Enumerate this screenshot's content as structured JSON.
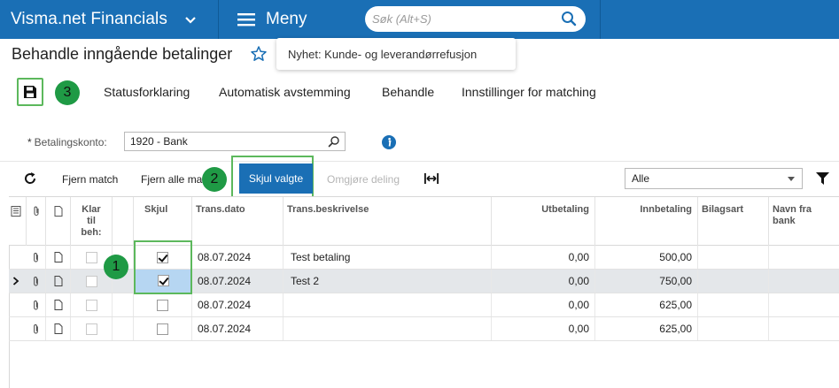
{
  "topbar": {
    "app_title": "Visma.net Financials",
    "menu_label": "Meny",
    "search_placeholder": "Søk (Alt+S)",
    "color": "#1a6fb5"
  },
  "page": {
    "title": "Behandle inngående betalinger",
    "news_tooltip": "Nyhet: Kunde- og leverandørrefusjon"
  },
  "toolbar": {
    "actions": [
      "Statusforklaring",
      "Automatisk avstemming",
      "Behandle",
      "Innstillinger for matching"
    ]
  },
  "callouts": [
    "1",
    "2",
    "3"
  ],
  "form": {
    "account_label": "Betalingskonto:",
    "required_mark": "*",
    "account_value": "1920 - Bank"
  },
  "grid_toolbar": {
    "remove_match": "Fjern match",
    "remove_all_matches": "Fjern alle ma",
    "hide_selected": "Skjul valgte",
    "undo_split": "Omgjøre deling",
    "filter_value": "Alle"
  },
  "grid": {
    "headers": {
      "ready": "Klar til behandling",
      "hide": "Skjul",
      "trans_date": "Trans.dato",
      "trans_desc": "Trans.beskrivelse",
      "payment_out": "Utbetaling",
      "payment_in": "Innbetaling",
      "voucher_type": "Bilagsart",
      "bank_name": "Navn fra bank"
    },
    "header_ready_lines": [
      "Klar",
      "til",
      "beh:"
    ],
    "header_bank_lines": [
      "Navn fra",
      "bank"
    ],
    "rows": [
      {
        "hide": true,
        "date": "08.07.2024",
        "desc": "Test betaling",
        "out": "0,00",
        "in": "500,00",
        "selected": false
      },
      {
        "hide": true,
        "date": "08.07.2024",
        "desc": "Test 2",
        "out": "0,00",
        "in": "750,00",
        "selected": true
      },
      {
        "hide": false,
        "date": "08.07.2024",
        "desc": "",
        "out": "0,00",
        "in": "625,00",
        "selected": false
      },
      {
        "hide": false,
        "date": "08.07.2024",
        "desc": "",
        "out": "0,00",
        "in": "625,00",
        "selected": false
      }
    ]
  }
}
